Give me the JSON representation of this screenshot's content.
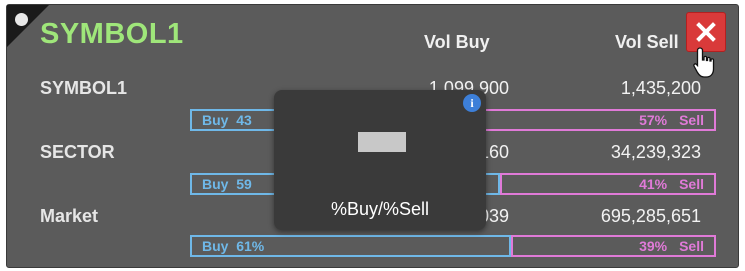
{
  "widget": {
    "title": "SYMBOL1",
    "columns": {
      "buy": "Vol Buy",
      "sell": "Vol Sell"
    },
    "close_icon": "close-x-icon",
    "cursor_icon": "hand-pointer-icon"
  },
  "rows": [
    {
      "label": "SYMBOL1",
      "vol_buy": "1,099,900",
      "vol_sell": "1,435,200",
      "buy_text": "Buy",
      "buy_pct": "43",
      "sell_pct": "57%",
      "sell_text": "Sell",
      "buy_fraction": 0.43
    },
    {
      "label": "SECTOR",
      "vol_buy": "160",
      "vol_sell": "34,239,323",
      "buy_text": "Buy",
      "buy_pct": "59",
      "sell_pct": "41%",
      "sell_text": "Sell",
      "buy_fraction": 0.59
    },
    {
      "label": "Market",
      "vol_buy": "039",
      "vol_sell": "695,285,651",
      "buy_text": "Buy",
      "buy_pct": "61%",
      "sell_pct": "39%",
      "sell_text": "Sell",
      "buy_fraction": 0.61
    }
  ],
  "tooltip": {
    "text": "%Buy/%Sell",
    "info_icon": "info-icon",
    "info_glyph": "i"
  },
  "colors": {
    "title": "#9fe67a",
    "buy_bar": "#6fb8e8",
    "sell_bar": "#e07ad8",
    "close": "#d93a3a",
    "panel": "#5b5b5b"
  }
}
